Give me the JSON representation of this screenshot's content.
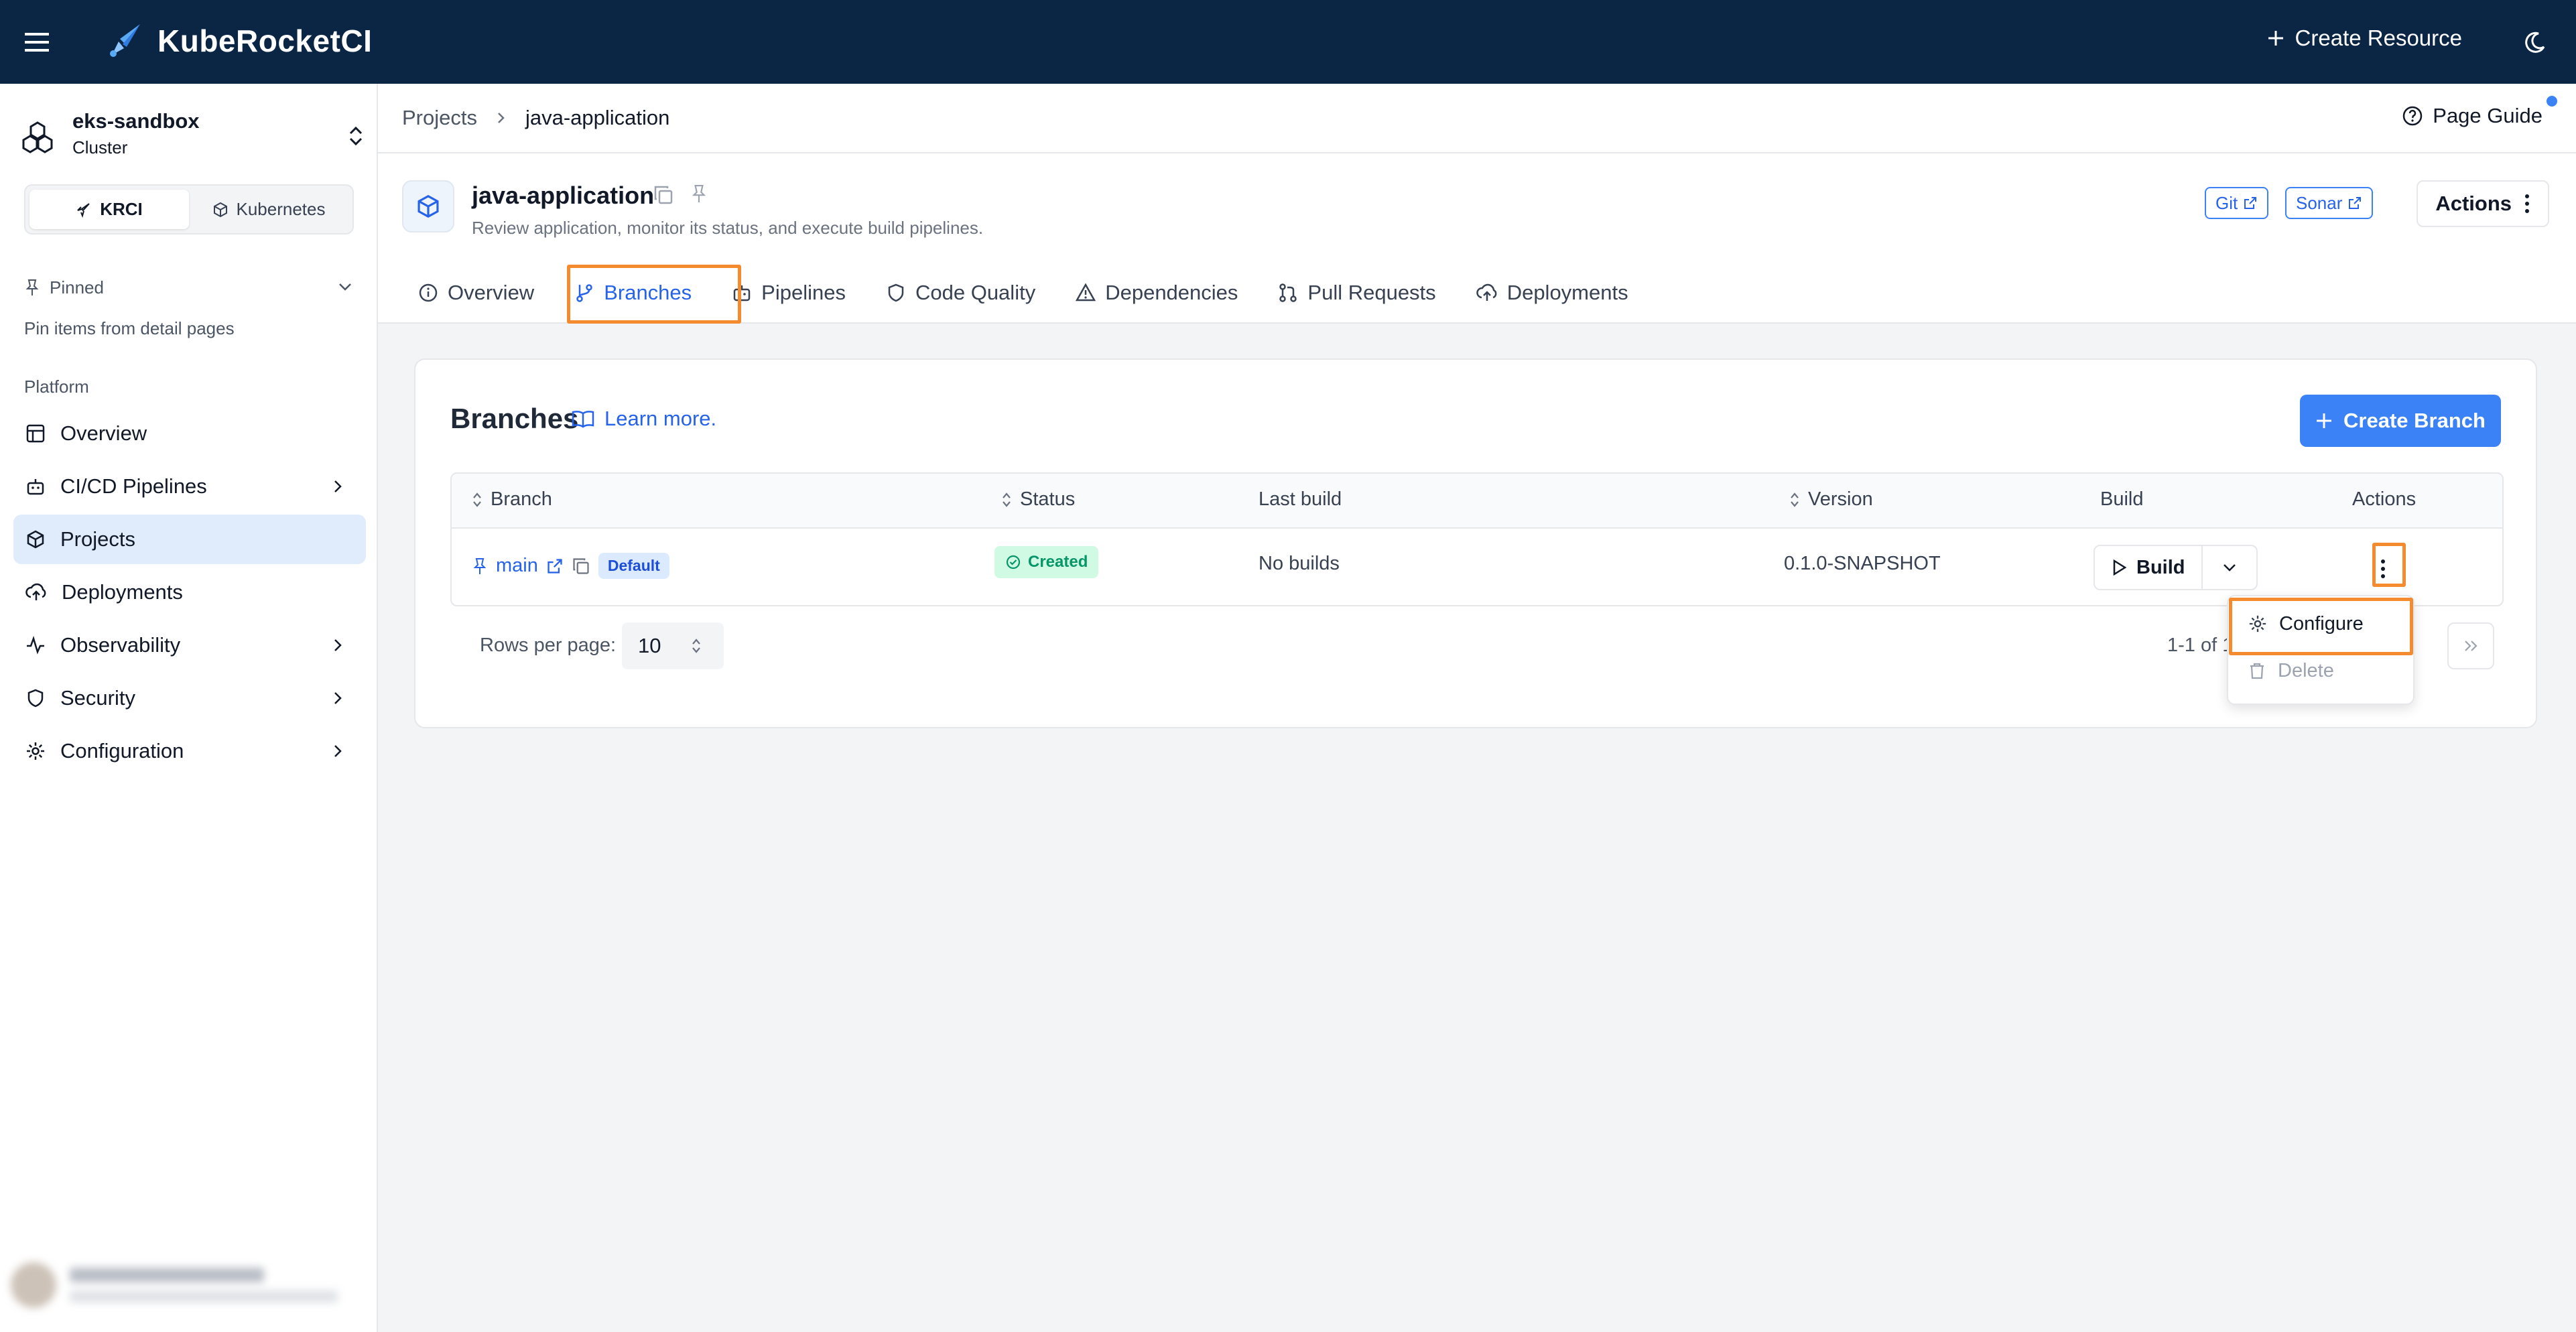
{
  "app": {
    "name": "KubeRocketCI",
    "create_resource_label": "Create Resource"
  },
  "sidebar": {
    "cluster_name": "eks-sandbox",
    "cluster_sub": "Cluster",
    "mode_tabs": [
      {
        "label": "KRCI",
        "active": true
      },
      {
        "label": "Kubernetes",
        "active": false
      }
    ],
    "pinned_label": "Pinned",
    "pinned_hint": "Pin items from detail pages",
    "section_label": "Platform",
    "items": [
      {
        "label": "Overview"
      },
      {
        "label": "CI/CD Pipelines"
      },
      {
        "label": "Projects"
      },
      {
        "label": "Deployments"
      },
      {
        "label": "Observability"
      },
      {
        "label": "Security"
      },
      {
        "label": "Configuration"
      }
    ]
  },
  "breadcrumb": {
    "root": "Projects",
    "current": "java-application"
  },
  "page_guide_label": "Page Guide",
  "project": {
    "title": "java-application",
    "description": "Review application, monitor its status, and execute build pipelines.",
    "links": [
      {
        "label": "Git"
      },
      {
        "label": "Sonar"
      }
    ],
    "actions_label": "Actions"
  },
  "tabs": [
    {
      "label": "Overview"
    },
    {
      "label": "Branches",
      "active": true
    },
    {
      "label": "Pipelines"
    },
    {
      "label": "Code Quality"
    },
    {
      "label": "Dependencies"
    },
    {
      "label": "Pull Requests"
    },
    {
      "label": "Deployments"
    }
  ],
  "branches": {
    "title": "Branches",
    "learn_more": "Learn more.",
    "create_label": "Create Branch",
    "columns": {
      "branch": "Branch",
      "status": "Status",
      "last_build": "Last build",
      "version": "Version",
      "build": "Build",
      "actions": "Actions"
    },
    "rows": [
      {
        "branch": "main",
        "badge": "Default",
        "status": "Created",
        "last_build": "No builds",
        "version": "0.1.0-SNAPSHOT",
        "build_label": "Build"
      }
    ],
    "pager": {
      "rows_per_page_label": "Rows per page:",
      "rows_per_page_value": "10",
      "range_text": "1-1 of 1"
    },
    "menu": {
      "configure": "Configure",
      "delete": "Delete"
    }
  },
  "colors": {
    "topbar": "#0b2545",
    "accent": "#3b82f6",
    "highlight": "#f48c2f",
    "status_created": "#059669"
  }
}
